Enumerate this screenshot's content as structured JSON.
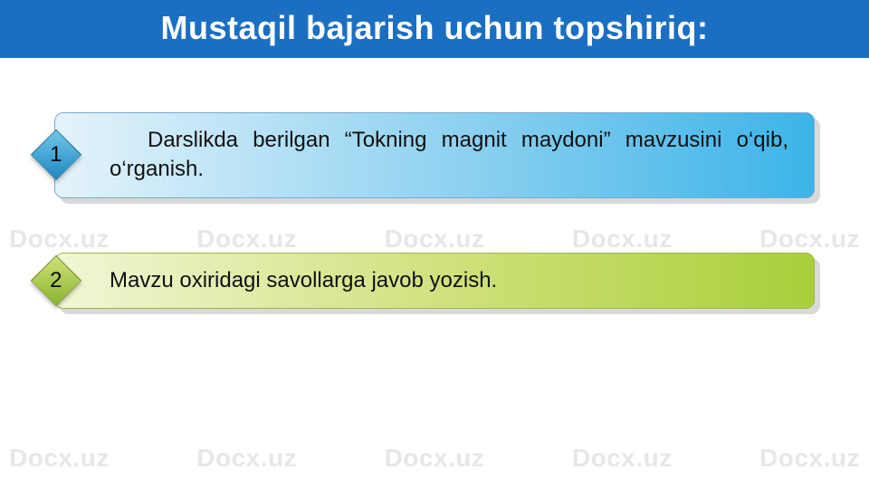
{
  "watermark": "Docx.uz",
  "title": "Mustaqil bajarish uchun topshiriq:",
  "items": [
    {
      "number": "1",
      "text": "Darslikda berilgan “Tokning magnit maydoni” mavzusini o‘qib, o‘rganish."
    },
    {
      "number": "2",
      "text": "Mavzu oxiridagi savollarga javob yozish."
    }
  ]
}
